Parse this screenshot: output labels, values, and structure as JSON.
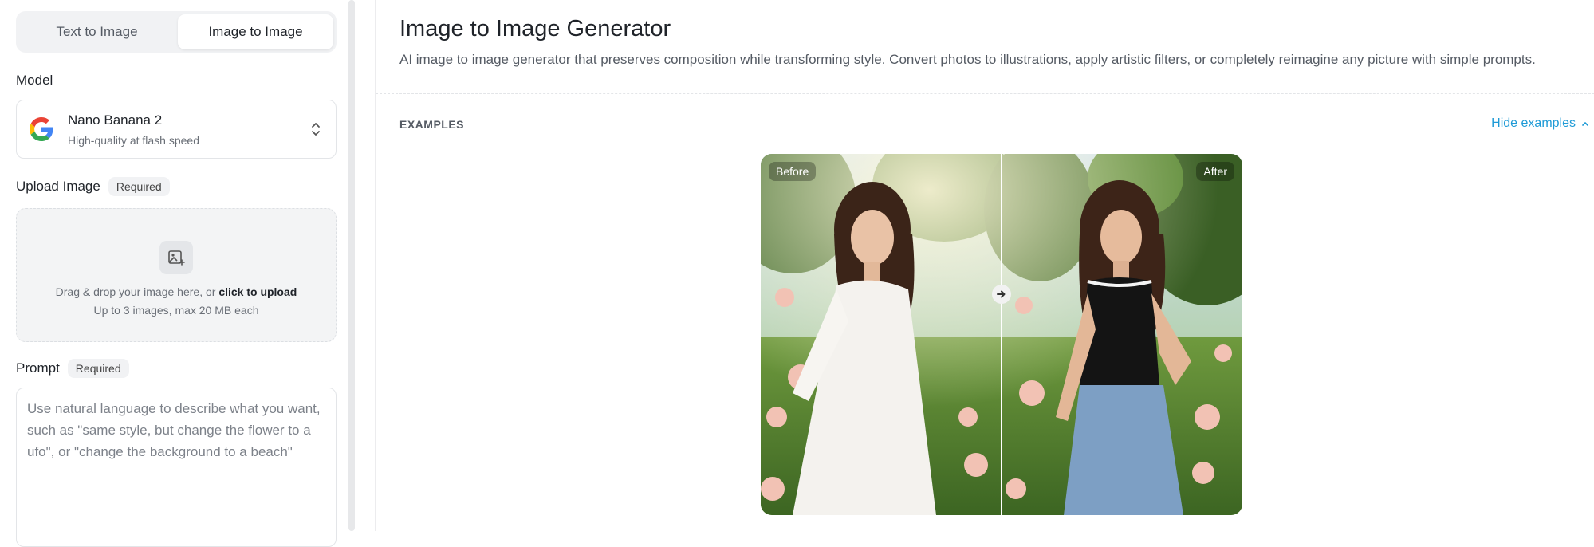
{
  "tabs": [
    {
      "label": "Text to Image",
      "active": false
    },
    {
      "label": "Image to Image",
      "active": true
    }
  ],
  "model": {
    "label": "Model",
    "name": "Nano Banana 2",
    "subtitle": "High-quality at flash speed",
    "logo_icon": "google-g-icon"
  },
  "upload": {
    "label": "Upload Image",
    "badge": "Required",
    "line1_prefix": "Drag & drop your image here, or ",
    "line1_link": "click to upload",
    "line2": "Up to 3 images, max 20 MB each"
  },
  "prompt": {
    "label": "Prompt",
    "badge": "Required",
    "placeholder": "Use natural language to describe what you want, such as \"same style, but change the flower to a ufo\", or \"change the background to a beach\"",
    "value": ""
  },
  "main": {
    "title": "Image to Image Generator",
    "description": "AI image to image generator that preserves composition while transforming style. Convert photos to illustrations, apply artistic filters, or completely reimagine any picture with simple prompts.",
    "examples_label": "EXAMPLES",
    "hide_examples": "Hide examples",
    "before_label": "Before",
    "after_label": "After"
  },
  "colors": {
    "accent_link": "#1e9ad6",
    "tab_bg": "#f1f2f4",
    "google_blue": "#4285F4",
    "google_red": "#EA4335",
    "google_yellow": "#FBBC05",
    "google_green": "#34A853"
  }
}
